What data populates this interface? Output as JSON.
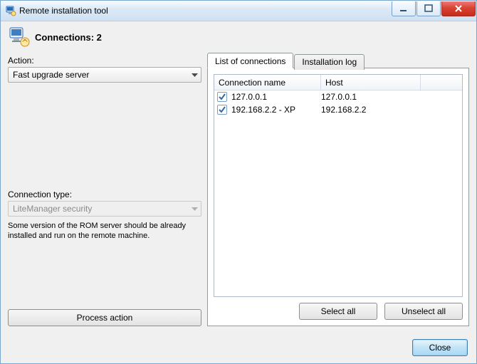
{
  "window": {
    "title": "Remote installation tool"
  },
  "header": {
    "label_prefix": "Connections:",
    "connection_count": 2,
    "full": "Connections: 2"
  },
  "left": {
    "action_label": "Action:",
    "action_value": "Fast upgrade server",
    "conn_type_label": "Connection type:",
    "conn_type_value": "LiteManager security",
    "help_text": "Some version of the ROM server should be already installed and run on the remote machine.",
    "process_button": "Process action"
  },
  "tabs": {
    "list_tab": "List of connections",
    "log_tab": "Installation log"
  },
  "listview": {
    "col_name": "Connection name",
    "col_host": "Host",
    "rows": [
      {
        "checked": true,
        "name": "127.0.0.1",
        "host": "127.0.0.1"
      },
      {
        "checked": true,
        "name": "192.168.2.2 - XP",
        "host": "192.168.2.2"
      }
    ],
    "row0_name": "127.0.0.1",
    "row0_host": "127.0.0.1",
    "row1_name": "192.168.2.2 - XP",
    "row1_host": "192.168.2.2"
  },
  "buttons": {
    "select_all": "Select all",
    "unselect_all": "Unselect all",
    "close": "Close"
  }
}
